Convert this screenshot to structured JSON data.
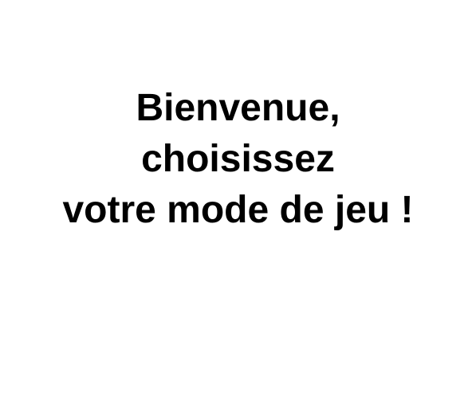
{
  "welcome": {
    "lines": [
      "Bienvenue,",
      "choisissez",
      "votre mode de jeu !"
    ]
  },
  "colors": {
    "background": "#ffffff",
    "text": "#000000"
  }
}
